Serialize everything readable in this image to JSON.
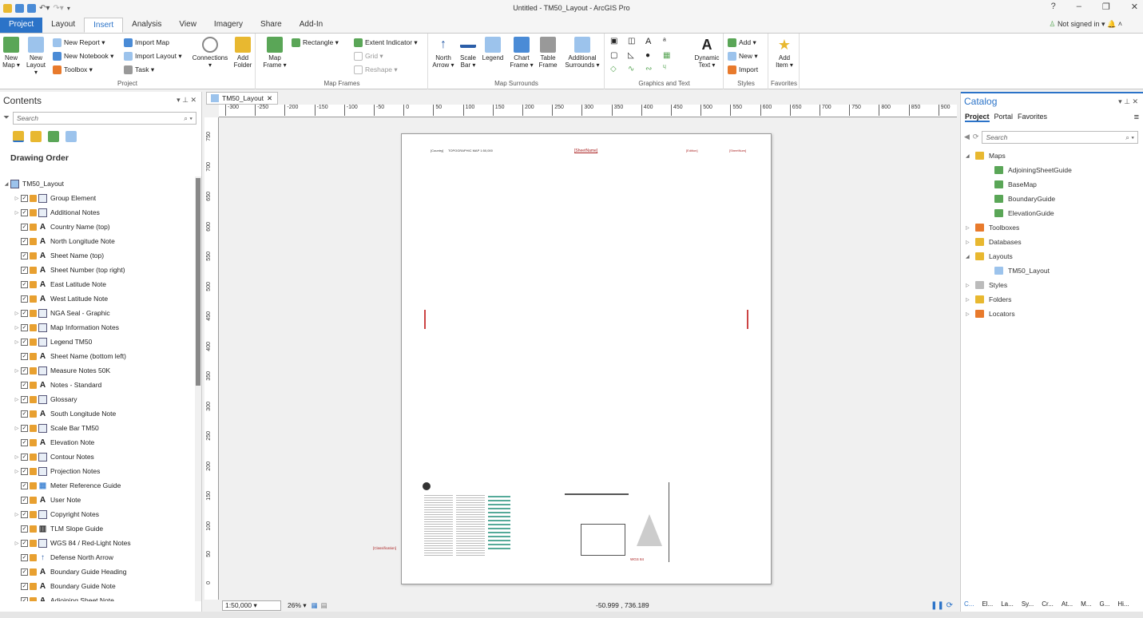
{
  "window": {
    "title": "Untitled - TM50_Layout - ArcGIS Pro",
    "help": "?",
    "minimize": "–",
    "restore": "❐",
    "close": "✕"
  },
  "menu": {
    "tabs": [
      "Project",
      "Layout",
      "Insert",
      "Analysis",
      "View",
      "Imagery",
      "Share",
      "Add-In"
    ],
    "active": "Insert",
    "signin": "Not signed in ▾"
  },
  "ribbon": {
    "project": {
      "label": "Project",
      "new_map": "New Map ▾",
      "new_layout": "New Layout ▾",
      "new_report": "New Report ▾",
      "new_notebook": "New Notebook ▾",
      "toolbox": "Toolbox ▾",
      "import_map": "Import Map",
      "import_layout": "Import Layout ▾",
      "task": "Task ▾",
      "connections": "Connections",
      "add_folder": "Add Folder"
    },
    "map_frames": {
      "label": "Map Frames",
      "map_frame": "Map Frame ▾",
      "rectangle": "Rectangle ▾",
      "extent_indicator": "Extent Indicator ▾",
      "grid": "Grid ▾",
      "reshape": "Reshape ▾"
    },
    "map_surrounds": {
      "label": "Map Surrounds",
      "north_arrow": "North Arrow ▾",
      "scale_bar": "Scale Bar ▾",
      "legend": "Legend",
      "chart_frame": "Chart Frame ▾",
      "table_frame": "Table Frame",
      "additional": "Additional Surrounds ▾"
    },
    "graphics": {
      "label": "Graphics and Text",
      "dynamic_text": "Dynamic Text ▾"
    },
    "styles": {
      "label": "Styles",
      "add": "Add ▾",
      "new": "New ▾",
      "import": "Import"
    },
    "favorites": {
      "label": "Favorites",
      "add_item": "Add Item ▾"
    }
  },
  "contents": {
    "title": "Contents",
    "search_placeholder": "Search",
    "drawing_order": "Drawing Order",
    "root": "TM50_Layout",
    "items": [
      {
        "label": "Group Element",
        "type": "group",
        "exp": true
      },
      {
        "label": "Additional Notes",
        "type": "group",
        "exp": true
      },
      {
        "label": "Country Name (top)",
        "type": "text",
        "exp": false
      },
      {
        "label": "North Longitude Note",
        "type": "text",
        "exp": false
      },
      {
        "label": "Sheet Name (top)",
        "type": "text",
        "exp": false
      },
      {
        "label": "Sheet Number (top right)",
        "type": "text",
        "exp": false
      },
      {
        "label": "East Latitude Note",
        "type": "text",
        "exp": false
      },
      {
        "label": "West Latitude Note",
        "type": "text",
        "exp": false
      },
      {
        "label": "NGA Seal - Graphic",
        "type": "group",
        "exp": true
      },
      {
        "label": "Map Information Notes",
        "type": "group",
        "exp": true
      },
      {
        "label": "Legend TM50",
        "type": "group",
        "exp": true
      },
      {
        "label": "Sheet Name (bottom left)",
        "type": "text",
        "exp": false
      },
      {
        "label": "Measure Notes 50K",
        "type": "group",
        "exp": true
      },
      {
        "label": "Notes - Standard",
        "type": "text",
        "exp": false
      },
      {
        "label": "Glossary",
        "type": "group",
        "exp": true
      },
      {
        "label": "South Longitude Note",
        "type": "text",
        "exp": false
      },
      {
        "label": "Scale Bar TM50",
        "type": "group",
        "exp": true
      },
      {
        "label": "Elevation Note",
        "type": "text",
        "exp": false
      },
      {
        "label": "Contour Notes",
        "type": "group",
        "exp": true
      },
      {
        "label": "Projection Notes",
        "type": "group",
        "exp": true
      },
      {
        "label": "Meter Reference Guide",
        "type": "table",
        "exp": false
      },
      {
        "label": "User Note",
        "type": "text",
        "exp": false
      },
      {
        "label": "Copyright Notes",
        "type": "group",
        "exp": true
      },
      {
        "label": "TLM Slope Guide",
        "type": "chart",
        "exp": false
      },
      {
        "label": "WGS 84 / Red-Light Notes",
        "type": "group",
        "exp": true
      },
      {
        "label": "Defense North Arrow",
        "type": "arrow",
        "exp": false
      },
      {
        "label": "Boundary Guide Heading",
        "type": "text",
        "exp": false
      },
      {
        "label": "Boundary Guide Note",
        "type": "text",
        "exp": false
      },
      {
        "label": "Adjoining Sheet Note",
        "type": "text",
        "exp": false
      }
    ]
  },
  "layout_view": {
    "tab": "TM50_Layout",
    "hticks": [
      "-300",
      "-250",
      "-200",
      "-150",
      "-100",
      "-50",
      "0",
      "50",
      "100",
      "150",
      "200",
      "250",
      "300",
      "350",
      "400",
      "450",
      "500",
      "550",
      "600",
      "650",
      "700",
      "750",
      "800",
      "850",
      "900"
    ],
    "vticks": [
      "750",
      "700",
      "650",
      "600",
      "550",
      "500",
      "450",
      "400",
      "350",
      "300",
      "250",
      "200",
      "150",
      "100",
      "50",
      "0"
    ],
    "page": {
      "country": "[Country]",
      "topo": "TOPOGRAPHIC MAP  1:50,000",
      "sheet_name": "[SheetName]",
      "sheet_num": "[SheetNum]",
      "edition": "[Edition]",
      "classification": "[Classification]",
      "wgs": "WGS 84"
    },
    "scale": "1:50,000",
    "zoom": "26% ▾",
    "coords": "-50.999 , 736.189"
  },
  "catalog": {
    "title": "Catalog",
    "tabs": [
      "Project",
      "Portal",
      "Favorites"
    ],
    "search_placeholder": "Search",
    "tree": [
      {
        "label": "Maps",
        "level": 0,
        "exp": "◢",
        "icon": "folder"
      },
      {
        "label": "AdjoiningSheetGuide",
        "level": 1,
        "exp": "",
        "icon": "map"
      },
      {
        "label": "BaseMap",
        "level": 1,
        "exp": "",
        "icon": "map"
      },
      {
        "label": "BoundaryGuide",
        "level": 1,
        "exp": "",
        "icon": "map"
      },
      {
        "label": "ElevationGuide",
        "level": 1,
        "exp": "",
        "icon": "map"
      },
      {
        "label": "Toolboxes",
        "level": 0,
        "exp": "▷",
        "icon": "folder-red"
      },
      {
        "label": "Databases",
        "level": 0,
        "exp": "▷",
        "icon": "folder-db"
      },
      {
        "label": "Layouts",
        "level": 0,
        "exp": "◢",
        "icon": "folder"
      },
      {
        "label": "TM50_Layout",
        "level": 1,
        "exp": "",
        "icon": "layout"
      },
      {
        "label": "Styles",
        "level": 0,
        "exp": "▷",
        "icon": "folder-style"
      },
      {
        "label": "Folders",
        "level": 0,
        "exp": "▷",
        "icon": "folder-y"
      },
      {
        "label": "Locators",
        "level": 0,
        "exp": "▷",
        "icon": "folder-loc"
      }
    ],
    "bottom_tabs": [
      "C...",
      "El...",
      "La...",
      "Sy...",
      "Cr...",
      "At...",
      "M...",
      "G...",
      "Hi..."
    ]
  },
  "colors": {
    "accent": "#2b73c8",
    "legend_red": "#a22222"
  }
}
